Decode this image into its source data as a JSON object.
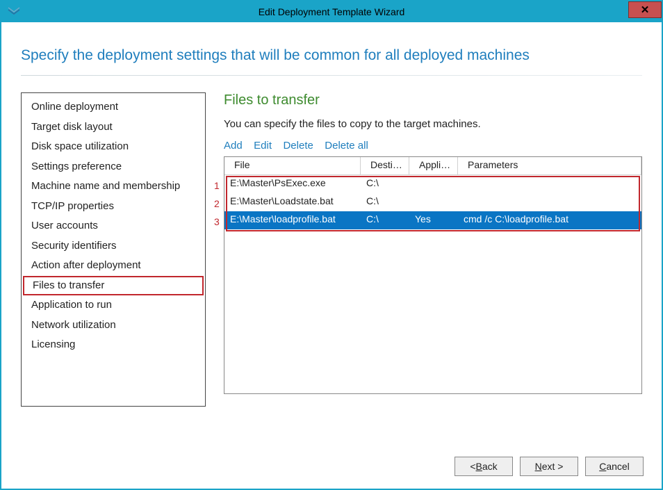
{
  "window": {
    "title": "Edit Deployment Template Wizard",
    "close": "✕"
  },
  "heading": "Specify the deployment settings that will be common for all deployed machines",
  "sidebar": {
    "items": [
      "Online deployment",
      "Target disk layout",
      "Disk space utilization",
      "Settings preference",
      "Machine name and membership",
      "TCP/IP properties",
      "User accounts",
      "Security identifiers",
      "Action after deployment",
      "Files to transfer",
      "Application to run",
      "Network utilization",
      "Licensing"
    ],
    "selected_index": 9
  },
  "main": {
    "section_title": "Files to transfer",
    "description": "You can specify the files to copy to the target machines.",
    "actions": {
      "add": "Add",
      "edit": "Edit",
      "delete": "Delete",
      "delete_all": "Delete all"
    },
    "table": {
      "headers": {
        "file": "File",
        "destination": "Destin…",
        "application": "Applic…",
        "parameters": "Parameters"
      },
      "rows": [
        {
          "num": "1",
          "file": "E:\\Master\\PsExec.exe",
          "dest": "C:\\",
          "app": "",
          "params": ""
        },
        {
          "num": "2",
          "file": "E:\\Master\\Loadstate.bat",
          "dest": "C:\\",
          "app": "",
          "params": ""
        },
        {
          "num": "3",
          "file": "E:\\Master\\loadprofile.bat",
          "dest": "C:\\",
          "app": "Yes",
          "params": "cmd /c C:\\loadprofile.bat"
        }
      ],
      "selected_index": 2
    }
  },
  "footer": {
    "back_prefix": "< ",
    "back_ul": "B",
    "back_rest": "ack",
    "next_ul": "N",
    "next_rest": "ext >",
    "cancel_ul": "C",
    "cancel_rest": "ancel"
  }
}
